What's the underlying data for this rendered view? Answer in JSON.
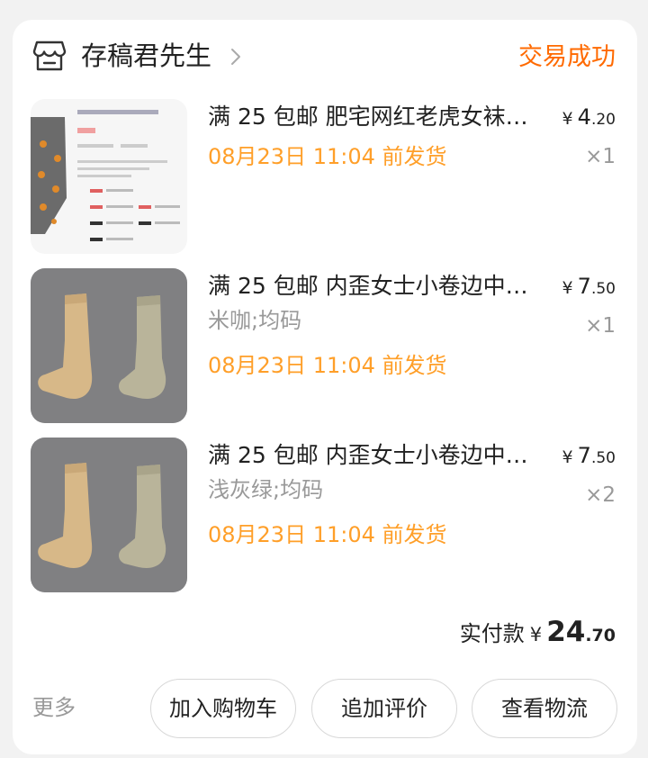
{
  "order": {
    "shop_name": "存稿君先生",
    "status": "交易成功",
    "status_color": "#ff6a00",
    "items": [
      {
        "title": "满 25 包邮 肥宅网红老虎女袜…",
        "spec": "",
        "ship_time": "08月23日 11:04 前发货",
        "price_currency": "¥",
        "price_int": "4",
        "price_dec": ".20",
        "qty": "×1"
      },
      {
        "title": "满 25 包邮 内歪女士小卷边中…",
        "spec": "米咖;均码",
        "ship_time": "08月23日 11:04 前发货",
        "price_currency": "¥",
        "price_int": "7",
        "price_dec": ".50",
        "qty": "×1"
      },
      {
        "title": "满 25 包邮 内歪女士小卷边中…",
        "spec": "浅灰绿;均码",
        "ship_time": "08月23日 11:04 前发货",
        "price_currency": "¥",
        "price_int": "7",
        "price_dec": ".50",
        "qty": "×2"
      }
    ],
    "total": {
      "label": "实付款",
      "currency": "¥",
      "int": "24",
      "dec": ".70"
    },
    "actions": {
      "more": "更多",
      "add_cart": "加入购物车",
      "add_review": "追加评价",
      "view_logistics": "查看物流"
    },
    "ship_color": "#ff9f29"
  }
}
